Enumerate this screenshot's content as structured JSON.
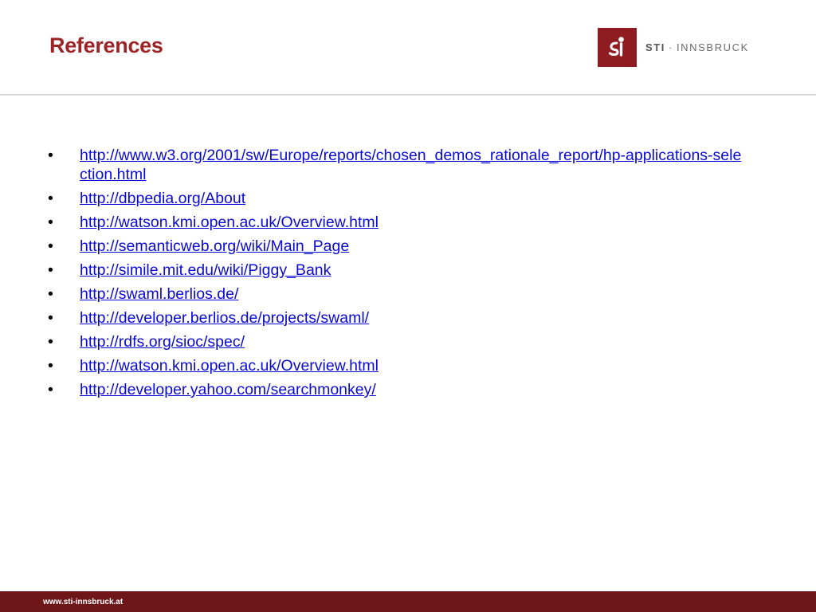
{
  "slide": {
    "title": "References"
  },
  "logo": {
    "brand": "STI",
    "separator": "·",
    "name": "INNSBRUCK"
  },
  "references": [
    "http://www.w3.org/2001/sw/Europe/reports/chosen_demos_rationale_report/hp-applications-selection.html",
    "http://dbpedia.org/About",
    "http://watson.kmi.open.ac.uk/Overview.html",
    "http://semanticweb.org/wiki/Main_Page",
    "http://simile.mit.edu/wiki/Piggy_Bank",
    "http://swaml.berlios.de/",
    "http://developer.berlios.de/projects/swaml/",
    "http://rdfs.org/sioc/spec/",
    "http://watson.kmi.open.ac.uk/Overview.html",
    "http://developer.yahoo.com/searchmonkey/"
  ],
  "footer": {
    "url": "www.sti-innsbruck.at"
  },
  "colors": {
    "title": "#9c2427",
    "brand": "#8e1c21",
    "footer": "#6f1619",
    "link": "#0a0ad6"
  }
}
